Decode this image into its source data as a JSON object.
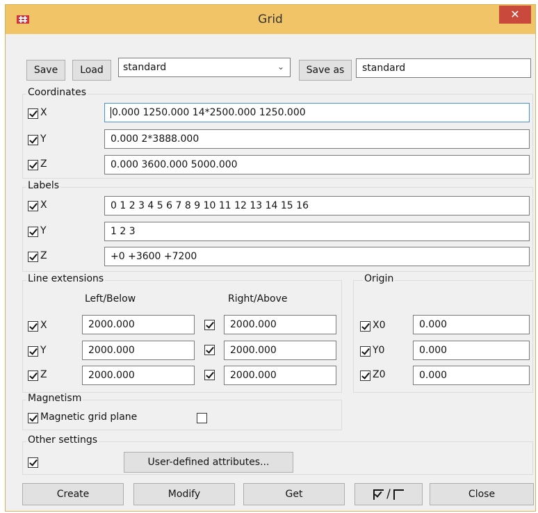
{
  "window": {
    "title": "Grid"
  },
  "top": {
    "save_label": "Save",
    "load_label": "Load",
    "preset_selected": "standard",
    "saveas_label": "Save as",
    "saveas_value": "standard"
  },
  "coordinates": {
    "heading": "Coordinates",
    "rows": [
      {
        "axis": "X",
        "value": "0.000 1250.000 14*2500.000 1250.000"
      },
      {
        "axis": "Y",
        "value": "0.000 2*3888.000"
      },
      {
        "axis": "Z",
        "value": "0.000 3600.000 5000.000"
      }
    ]
  },
  "labels": {
    "heading": "Labels",
    "rows": [
      {
        "axis": "X",
        "value": "0 1 2 3 4 5 6 7 8 9 10 11 12 13 14 15 16"
      },
      {
        "axis": "Y",
        "value": "1 2 3"
      },
      {
        "axis": "Z",
        "value": "+0 +3600 +7200"
      }
    ]
  },
  "line_extensions": {
    "heading": "Line extensions",
    "left_header": "Left/Below",
    "right_header": "Right/Above",
    "rows": [
      {
        "axis": "X",
        "left": "2000.000",
        "right": "2000.000"
      },
      {
        "axis": "Y",
        "left": "2000.000",
        "right": "2000.000"
      },
      {
        "axis": "Z",
        "left": "2000.000",
        "right": "2000.000"
      }
    ]
  },
  "origin": {
    "heading": "Origin",
    "rows": [
      {
        "axis": "X0",
        "value": "0.000"
      },
      {
        "axis": "Y0",
        "value": "0.000"
      },
      {
        "axis": "Z0",
        "value": "0.000"
      }
    ]
  },
  "magnetism": {
    "heading": "Magnetism",
    "option_label": "Magnetic grid plane"
  },
  "other": {
    "heading": "Other settings",
    "udattr_label": "User-defined attributes..."
  },
  "bottom": {
    "create_label": "Create",
    "modify_label": "Modify",
    "get_label": "Get",
    "toggle_sep": "/",
    "close_label": "Close"
  },
  "colors": {
    "titlebar": "#f1c468",
    "close": "#c94a3d",
    "dialog": "#f0f0f0",
    "focus": "#4a8fd9"
  }
}
